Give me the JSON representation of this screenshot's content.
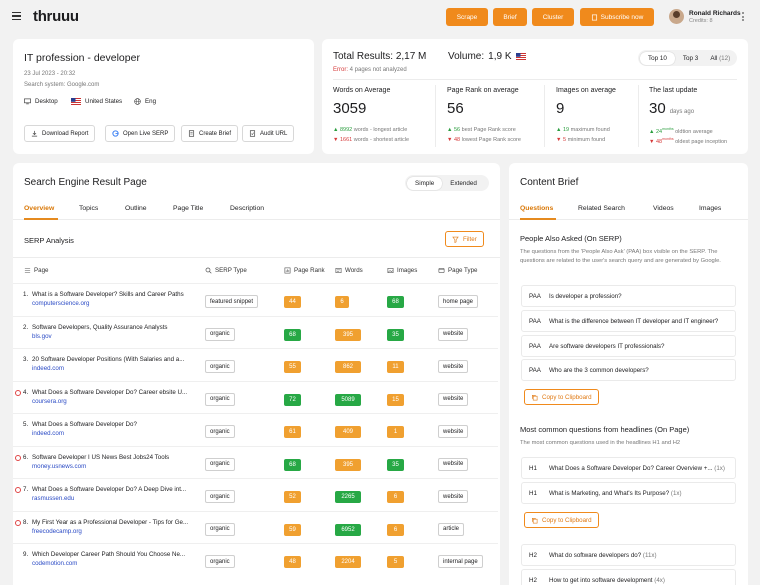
{
  "app": {
    "logo": "thruuu",
    "buttons": {
      "scrape": "Scrape",
      "brief": "Brief",
      "cluster": "Cluster",
      "subscribe": "Subscribe now"
    },
    "user": {
      "name": "Ronald Richards",
      "credits": "Credits: 8"
    },
    "accent": "#f08a1c"
  },
  "query": {
    "title": "IT profession - developer",
    "date": "23 Jul 2023 - 20:32",
    "search_system": "Search system: Google.com",
    "device": "Desktop",
    "country": "United States",
    "lang": "Eng",
    "actions": {
      "download": "Download Report",
      "serp": "Open Live SERP",
      "brief": "Create Brief",
      "audit": "Audit URL"
    }
  },
  "summary": {
    "total_label": "Total Results:",
    "total_value": "2,17 M",
    "volume_label": "Volume:",
    "volume_value": "1,9 K",
    "error": "Error:",
    "error_text": "4 pages not analyzed",
    "toggle": [
      "Top 10",
      "Top 3",
      "All"
    ],
    "all_count": "(12)",
    "stats": [
      {
        "label": "Words on Average",
        "value": "3059",
        "up_val": "8992",
        "up_text": "words - longest article",
        "down_val": "1661",
        "down_text": "words - shortest article"
      },
      {
        "label": "Page Rank on average",
        "value": "56",
        "up_val": "56",
        "up_text": "best Page Rank score",
        "down_val": "48",
        "down_text": "lowest Page Rank score"
      },
      {
        "label": "Images on average",
        "value": "9",
        "up_val": "19",
        "up_text": "maximum found",
        "down_val": "5",
        "down_text": "minimum found"
      },
      {
        "label": "The last update",
        "value": "30",
        "value_unit": "days ago",
        "up_val": "24",
        "up_sup": "months",
        "up_text": "oldtion average",
        "down_val": "48",
        "down_sup": "months",
        "down_text": "oldest page inception"
      }
    ]
  },
  "serp": {
    "title": "Search Engine Result Page",
    "seg": [
      "Simple",
      "Extended"
    ],
    "tabs": [
      "Overview",
      "Topics",
      "Outline",
      "Page Title",
      "Description"
    ],
    "analysis_title": "SERP Analysis",
    "filter": "Filter",
    "columns": [
      "Page",
      "SERP Type",
      "Page Rank",
      "Words",
      "Images",
      "Page Type"
    ],
    "rows": [
      {
        "n": "1.",
        "title": "What is a Software Developer? Skills and Career Paths",
        "domain": "computerscience.org",
        "serp_type": "featured snippet",
        "rank": "44",
        "words": "6",
        "images": "68",
        "page_type": "home page",
        "warn": false
      },
      {
        "n": "2.",
        "title": "Software Developers, Quality Assurance Analysts",
        "domain": "bls.gov",
        "serp_type": "organic",
        "rank": "68",
        "words": "395",
        "images": "35",
        "page_type": "website",
        "warn": false
      },
      {
        "n": "3.",
        "title": "20 Software Developer Positions (With Salaries and a...",
        "domain": "indeed.com",
        "serp_type": "organic",
        "rank": "55",
        "words": "862",
        "images": "11",
        "page_type": "website",
        "warn": false
      },
      {
        "n": "4.",
        "title": "What Does a Software Developer Do? Career ebsite U...",
        "domain": "coursera.org",
        "serp_type": "organic",
        "rank": "72",
        "words": "5089",
        "images": "15",
        "page_type": "website",
        "warn": true
      },
      {
        "n": "5.",
        "title": "What Does a Software Developer Do?",
        "domain": "indeed.com",
        "serp_type": "organic",
        "rank": "61",
        "words": "409",
        "images": "1",
        "page_type": "website",
        "warn": false
      },
      {
        "n": "6.",
        "title": "Software Developer I US News Best Jobs24 Tools",
        "domain": "money.usnews.com",
        "serp_type": "organic",
        "rank": "68",
        "words": "395",
        "images": "35",
        "page_type": "website",
        "warn": true
      },
      {
        "n": "7.",
        "title": "What Does a Software Developer Do? A Deep Dive int...",
        "domain": "rasmussen.edu",
        "serp_type": "organic",
        "rank": "52",
        "words": "2265",
        "images": "6",
        "page_type": "website",
        "warn": true
      },
      {
        "n": "8.",
        "title": "My First Year as a Professional Developer - Tips for Ge...",
        "domain": "freecodecamp.org",
        "serp_type": "organic",
        "rank": "59",
        "words": "6952",
        "images": "6",
        "page_type": "article",
        "warn": true
      },
      {
        "n": "9.",
        "title": "Which Developer Career Path Should You Choose Ne...",
        "domain": "codemotion.com",
        "serp_type": "organic",
        "rank": "48",
        "words": "2204",
        "images": "5",
        "page_type": "internal page",
        "warn": false
      }
    ]
  },
  "brief": {
    "title": "Content Brief",
    "tabs": [
      "Questions",
      "Related Search",
      "Videos",
      "Images"
    ],
    "paa_title": "People Also Asked (On SERP)",
    "paa_desc": "The questions from the 'People Also Ask' (PAA) box visible on the SERP. The questions are related to the user's search query and are generated by Google.",
    "paa": [
      {
        "k": "PAA",
        "q": "Is developer a profession?"
      },
      {
        "k": "PAA",
        "q": "What is the difference between IT developer and IT engineer?"
      },
      {
        "k": "PAA",
        "q": "Are software developers IT professionals?"
      },
      {
        "k": "PAA",
        "q": "Who are the 3 common developers?"
      }
    ],
    "copy": "Copy to Clipboard",
    "common_title": "Most common questions from headlines (On Page)",
    "common_desc": "The most common questions used in the headlines H1 and H2",
    "h1": [
      {
        "k": "H1",
        "q": "What Does a Software Developer Do? Career Overview +...",
        "c": "(1x)"
      },
      {
        "k": "H1",
        "q": "What is Marketing, and What's Its Purpose?",
        "c": "(1x)"
      }
    ],
    "h2": [
      {
        "k": "H2",
        "q": "What do software developers do?",
        "c": "(11x)"
      },
      {
        "k": "H2",
        "q": "How to get into software development",
        "c": "(4x)"
      }
    ]
  }
}
